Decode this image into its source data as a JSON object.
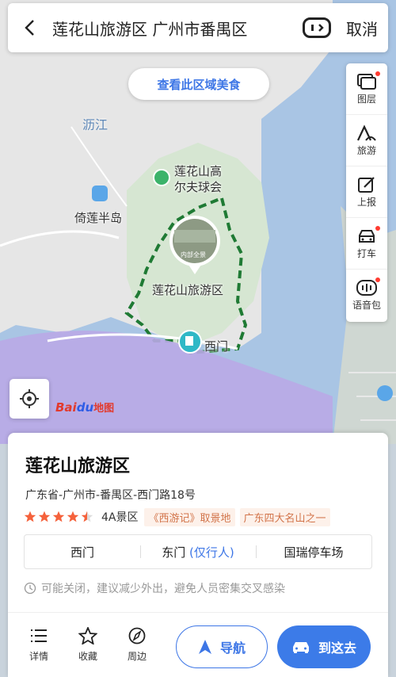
{
  "search_bar": {
    "query": "莲花山旅游区 广州市番禺区",
    "cancel_label": "取消"
  },
  "map": {
    "food_pill_label": "查看此区域美食",
    "labels": {
      "river": "沥江",
      "golf": "莲花山高\n尔夫球会",
      "island": "倚莲半岛",
      "scenic": "莲花山旅游区",
      "gate": "西门",
      "panorama": "内部全景"
    },
    "logo": {
      "bai": "Bai",
      "du": "du",
      "map": "地图"
    }
  },
  "toolbar": [
    {
      "label": "图层",
      "icon": "layers-icon",
      "dot": true
    },
    {
      "label": "旅游",
      "icon": "travel-icon",
      "dot": false
    },
    {
      "label": "上报",
      "icon": "report-icon",
      "dot": false
    },
    {
      "label": "打车",
      "icon": "taxi-icon",
      "dot": true
    },
    {
      "label": "语音包",
      "icon": "voice-pack-icon",
      "dot": true
    }
  ],
  "poi": {
    "title": "莲花山旅游区",
    "address": "广东省-广州市-番禺区-西门路18号",
    "rating": 4.5,
    "level": "4A景区",
    "tags": [
      "《西游记》取景地",
      "广东四大名山之一"
    ],
    "gates": [
      {
        "name": "西门",
        "sub": ""
      },
      {
        "name": "东门",
        "sub": "(仅行人)"
      },
      {
        "name": "国瑞停车场",
        "sub": ""
      }
    ],
    "notice": "可能关闭，建议减少外出，避免人员密集交叉感染"
  },
  "actions": {
    "details": "详情",
    "favorite": "收藏",
    "nearby": "周边",
    "navigate": "导航",
    "go_here": "到这去"
  },
  "colors": {
    "accent": "#3c7be8",
    "boundary": "#1f7a34",
    "tag_text": "#d2744a",
    "star": "#f5623c"
  }
}
